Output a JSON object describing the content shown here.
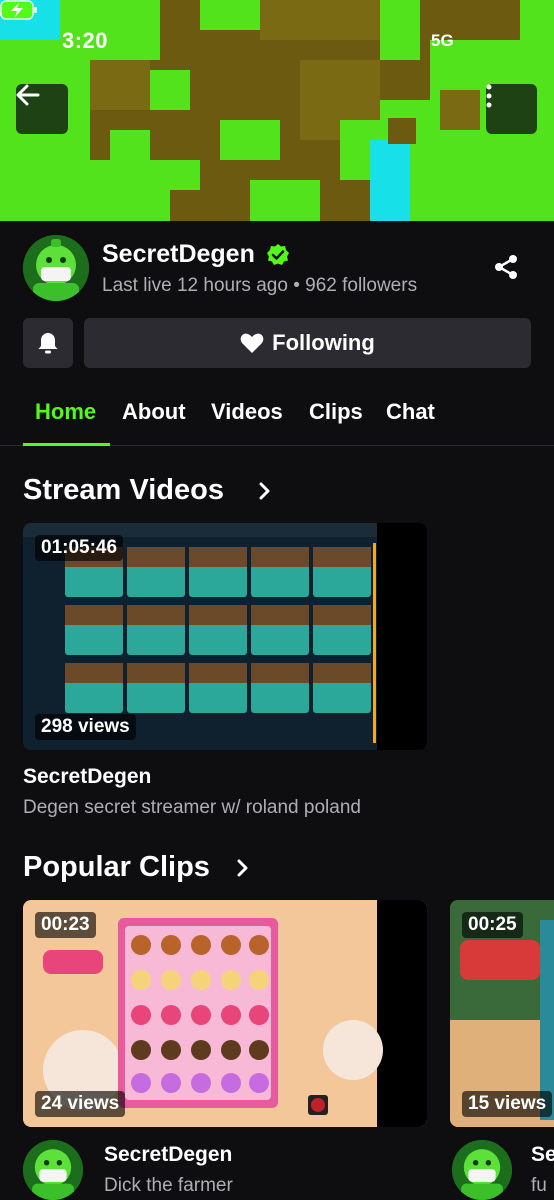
{
  "status_bar": {
    "time": "3:20",
    "network": "5G"
  },
  "channel": {
    "name": "SecretDegen",
    "last_live": "Last live 12 hours ago",
    "followers": "962 followers",
    "follow_label": "Following"
  },
  "tabs": [
    {
      "label": "Home",
      "active": true
    },
    {
      "label": "About",
      "active": false
    },
    {
      "label": "Videos",
      "active": false
    },
    {
      "label": "Clips",
      "active": false
    },
    {
      "label": "Chat",
      "active": false
    }
  ],
  "stream_videos": {
    "title": "Stream Videos",
    "items": [
      {
        "duration": "01:05:46",
        "views": "298 views",
        "channel": "SecretDegen",
        "description": "Degen secret streamer w/ roland poland"
      }
    ]
  },
  "popular_clips": {
    "title": "Popular Clips",
    "items": [
      {
        "duration": "00:23",
        "views": "24 views",
        "channel": "SecretDegen",
        "description": "Dick the farmer"
      },
      {
        "duration": "00:25",
        "views": "15 views",
        "channel": "Se",
        "description": "fu"
      }
    ]
  },
  "icons": {
    "back": "arrow-left-icon",
    "more": "more-vertical-icon",
    "verified": "verified-check-icon",
    "share": "share-icon",
    "bell": "bell-icon",
    "heart": "heart-icon",
    "chevron": "chevron-right-icon"
  },
  "colors": {
    "brand_green": "#53fc18",
    "background": "#0e0e10",
    "button_bg": "#2b2b31",
    "muted_text": "#aeaeb5"
  }
}
